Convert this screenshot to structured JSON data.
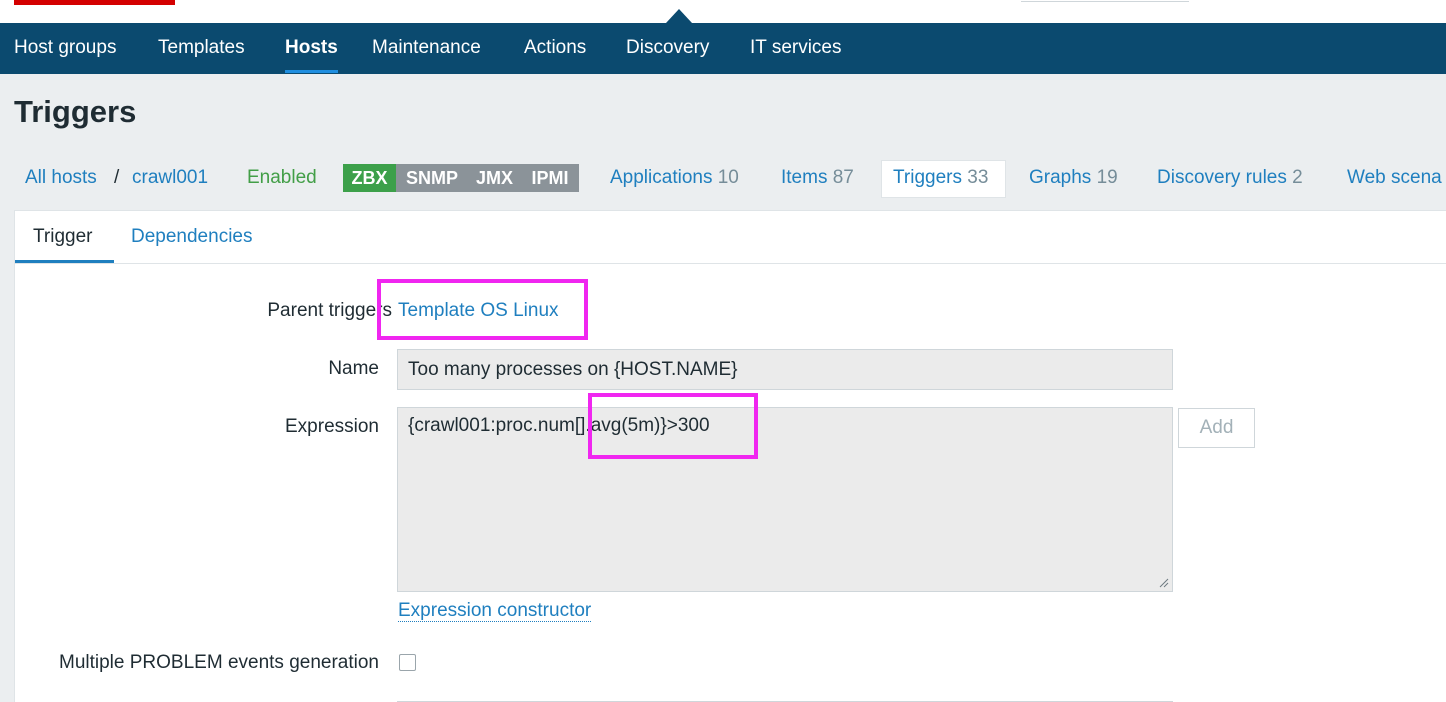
{
  "main_nav": {
    "items": [
      {
        "label": "Host groups",
        "active": false
      },
      {
        "label": "Templates",
        "active": false
      },
      {
        "label": "Hosts",
        "active": true
      },
      {
        "label": "Maintenance",
        "active": false
      },
      {
        "label": "Actions",
        "active": false
      },
      {
        "label": "Discovery",
        "active": false
      },
      {
        "label": "IT services",
        "active": false
      }
    ]
  },
  "page_title": "Triggers",
  "breadcrumb": {
    "all_hosts": "All hosts",
    "separator": "/",
    "host": "crawl001",
    "status": "Enabled",
    "availability": [
      "ZBX",
      "SNMP",
      "JMX",
      "IPMI"
    ],
    "links": [
      {
        "label": "Applications",
        "count": "10"
      },
      {
        "label": "Items",
        "count": "87"
      },
      {
        "label": "Triggers",
        "count": "33"
      },
      {
        "label": "Graphs",
        "count": "19"
      },
      {
        "label": "Discovery rules",
        "count": "2"
      },
      {
        "label": "Web scena",
        "count": ""
      }
    ]
  },
  "tabs": {
    "trigger": "Trigger",
    "dependencies": "Dependencies"
  },
  "form": {
    "parent_triggers_label": "Parent triggers",
    "parent_triggers_value": "Template OS Linux",
    "name_label": "Name",
    "name_value": "Too many processes on {HOST.NAME}",
    "expression_label": "Expression",
    "expression_value": "{crawl001:proc.num[].avg(5m)}>300",
    "add_button": "Add",
    "expression_constructor": "Expression constructor",
    "multiple_problem_label": "Multiple PROBLEM events generation",
    "multiple_problem_checked": false
  },
  "colors": {
    "nav_bg": "#0b4a6f",
    "link": "#1f7fbf",
    "highlight": "#f026f0",
    "zbx_green": "#3ca04a",
    "enabled_green": "#429e47"
  }
}
